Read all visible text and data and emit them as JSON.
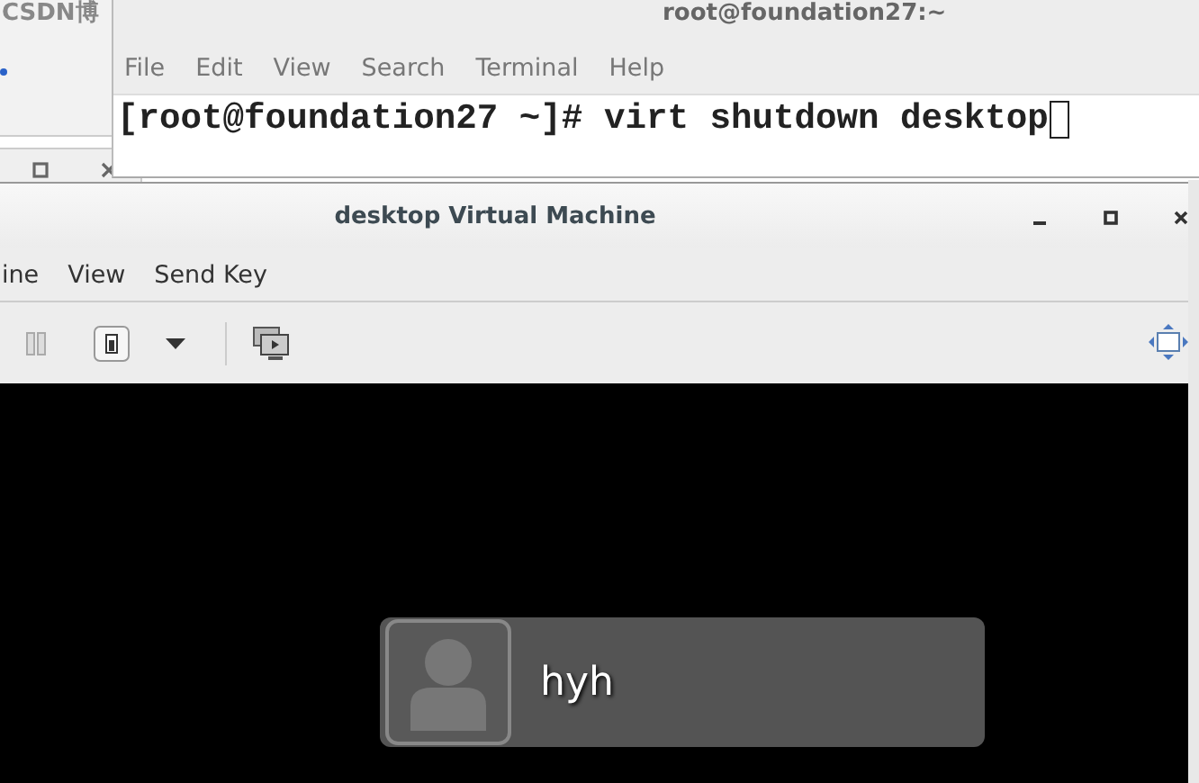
{
  "background_window": {
    "title": "CSDN博"
  },
  "terminal": {
    "title": "root@foundation27:~",
    "menu": [
      "File",
      "Edit",
      "View",
      "Search",
      "Terminal",
      "Help"
    ],
    "lines": [
      "[root@foundation27 ~]# virt shutdown desktop"
    ],
    "cursor": true
  },
  "vm_window": {
    "title": "desktop Virtual Machine",
    "menu": [
      "ine",
      "View",
      "Send Key"
    ],
    "login": {
      "user": "hyh"
    }
  }
}
